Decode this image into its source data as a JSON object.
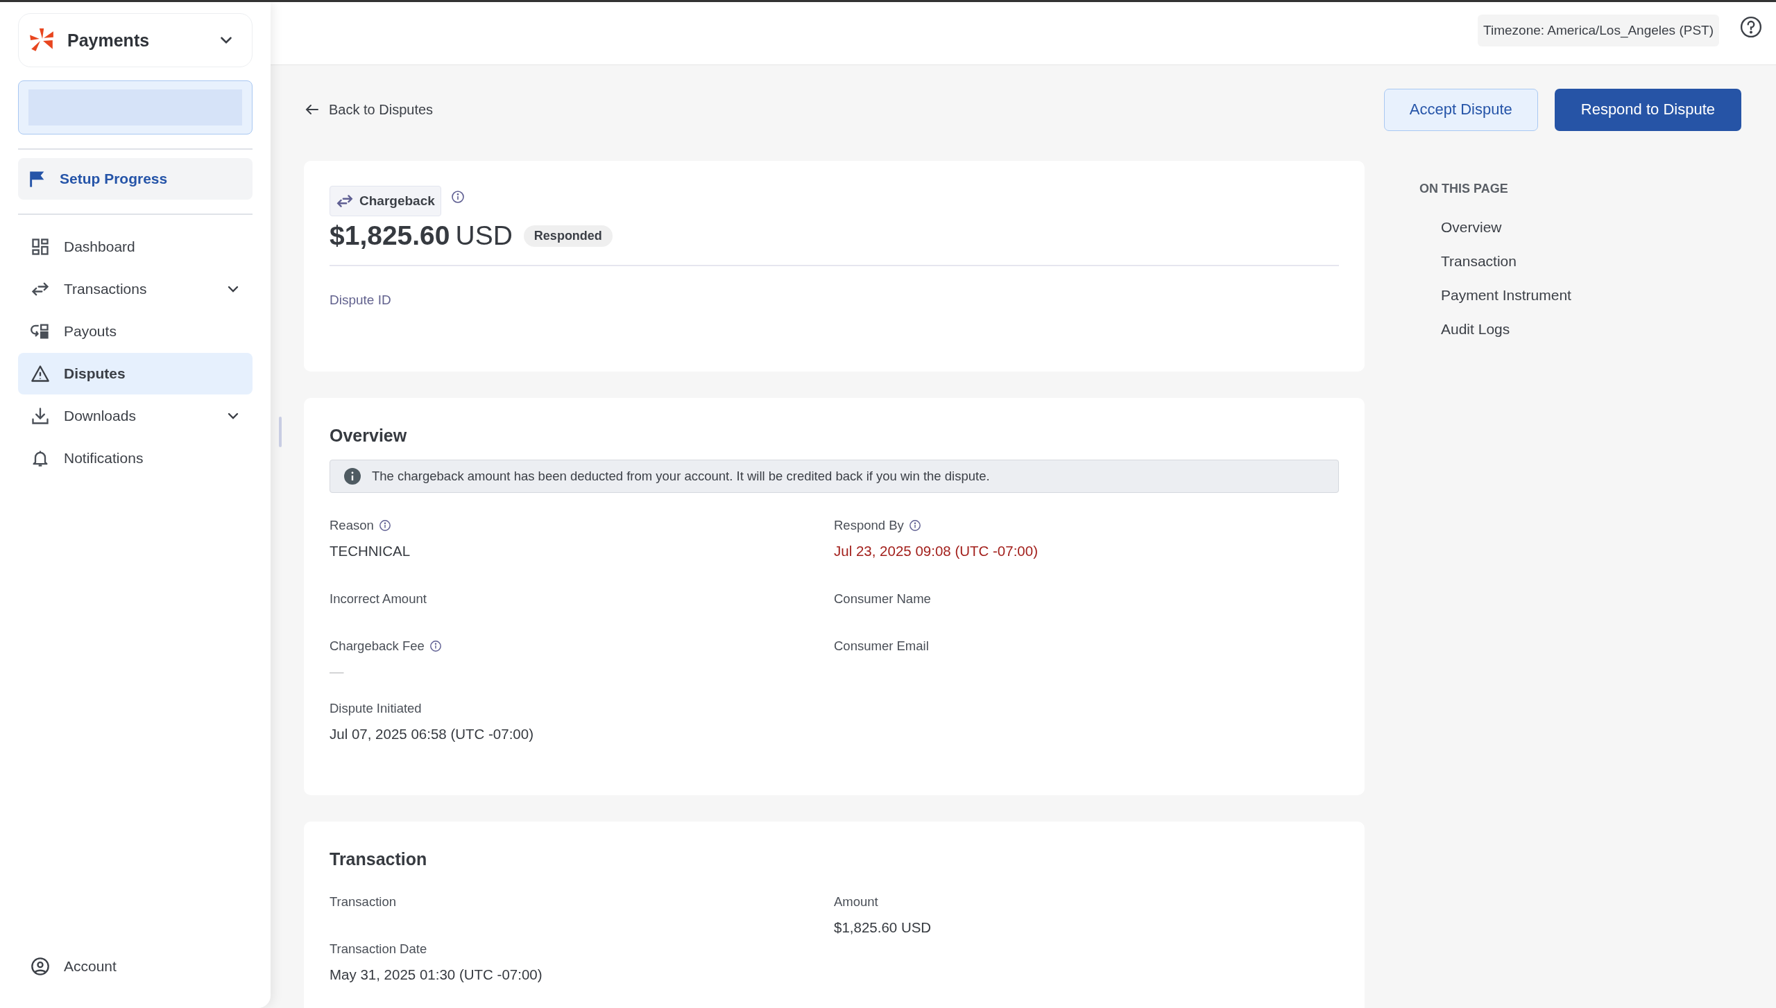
{
  "sidebar": {
    "brand": "Payments",
    "setup": {
      "label": "Setup Progress"
    },
    "nav": [
      {
        "label": "Dashboard",
        "selected": false,
        "expandable": false
      },
      {
        "label": "Transactions",
        "selected": false,
        "expandable": true
      },
      {
        "label": "Payouts",
        "selected": false,
        "expandable": false
      },
      {
        "label": "Disputes",
        "selected": true,
        "expandable": false
      },
      {
        "label": "Downloads",
        "selected": false,
        "expandable": true
      },
      {
        "label": "Notifications",
        "selected": false,
        "expandable": false
      }
    ],
    "account": {
      "label": "Account"
    }
  },
  "topbar": {
    "timezone": "Timezone: America/Los_Angeles (PST)"
  },
  "back_link": "Back to Disputes",
  "actions": [
    {
      "label": "Accept Dispute",
      "kind": "secondary"
    },
    {
      "label": "Respond to Dispute",
      "kind": "primary"
    }
  ],
  "summary": {
    "type": "Chargeback",
    "amount": "$1,825.60",
    "currency": "USD",
    "status": "Responded",
    "fields": [
      {
        "label": "Dispute ID"
      }
    ]
  },
  "overview": {
    "title": "Overview",
    "notice": "The chargeback amount has been deducted from your account. It will be credited back if you win the dispute.",
    "columns": [
      [
        {
          "label": "Reason",
          "info": true,
          "value": "TECHNICAL",
          "alert": false,
          "muted": false
        },
        {
          "label": "Incorrect Amount",
          "info": false
        },
        {
          "label": "Chargeback Fee",
          "info": true,
          "value": "—",
          "alert": false,
          "muted": true
        },
        {
          "label": "Dispute Initiated",
          "info": false,
          "value": "Jul 07, 2025 06:58 (UTC -07:00)",
          "alert": false,
          "muted": false
        }
      ],
      [
        {
          "label": "Respond By",
          "info": true,
          "value": "Jul 23, 2025 09:08 (UTC -07:00)",
          "alert": true,
          "muted": false
        },
        {
          "label": "Consumer Name",
          "info": false
        },
        {
          "label": "Consumer Email",
          "info": false
        }
      ]
    ]
  },
  "transaction": {
    "title": "Transaction",
    "columns": [
      [
        {
          "label": "Transaction",
          "info": false
        },
        {
          "label": "Transaction Date",
          "info": false,
          "value": "May 31, 2025 01:30 (UTC -07:00)",
          "alert": false,
          "muted": false
        }
      ],
      [
        {
          "label": "Amount",
          "info": false,
          "value": "$1,825.60 USD",
          "alert": false,
          "muted": false
        }
      ]
    ]
  },
  "toc": {
    "heading": "ON THIS PAGE",
    "items": [
      "Overview",
      "Transaction",
      "Payment Instrument",
      "Audit Logs"
    ]
  }
}
